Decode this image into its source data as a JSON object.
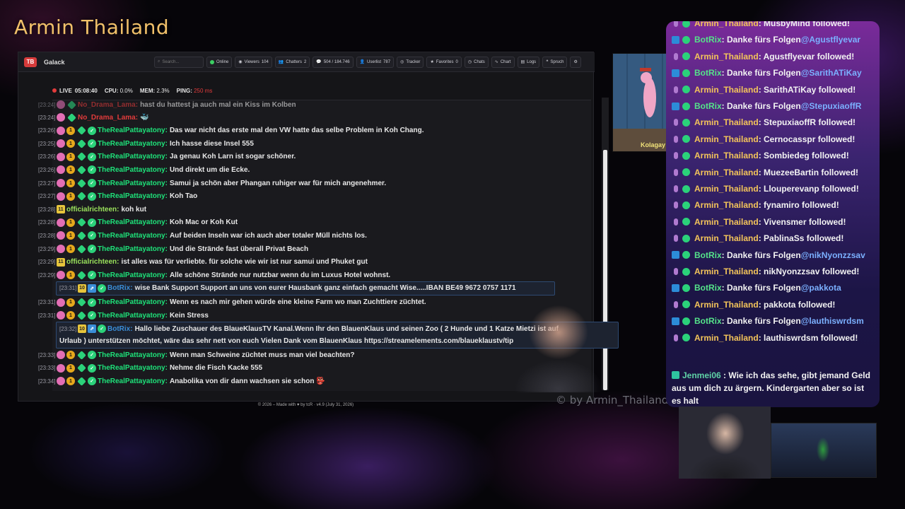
{
  "stream_title": "Armin Thailand",
  "app": {
    "logo_text": "TB",
    "name": "Galack",
    "search_placeholder": "Search...",
    "toolbar": {
      "online": "Online",
      "viewers": "Viewers",
      "viewers_count": "104",
      "chatters": "Chatters",
      "chatters_count": "2",
      "messages": "504 / 184.746",
      "userlist": "Userlist",
      "userlist_count": "787",
      "tracker": "Tracker",
      "favorites": "Favorites",
      "favorites_count": "0",
      "chats": "Chats",
      "chart": "Chart",
      "logs": "Logs",
      "spruch": "Spruch"
    },
    "status": {
      "live": "LIVE",
      "live_time": "05:08:40",
      "cpu_label": "CPU:",
      "cpu": "0.0%",
      "mem_label": "MEM:",
      "mem": "2.3%",
      "ping_label": "PING:",
      "ping": "250 ms"
    },
    "footer": "© 2026 – Made with ♥ by tcR · v4.9 (July 31, 2026)"
  },
  "chat": [
    {
      "time": "[23:24]",
      "user": "No_Drama_Lama",
      "color": "red",
      "badges": [
        "pink",
        "dia"
      ],
      "text": "hast du hattest ja auch mal ein Kiss im Kolben"
    },
    {
      "time": "[23:24]",
      "user": "No_Drama_Lama",
      "color": "red",
      "badges": [
        "pink",
        "dia"
      ],
      "text": "🐳"
    },
    {
      "time": "[23:26]",
      "user": "TheRealPattayatony",
      "color": "green",
      "badges": [
        "pink",
        "gold",
        "dia",
        "ver"
      ],
      "text": "Das war nicht das erste mal den VW hatte das selbe Problem in Koh Chang."
    },
    {
      "time": "[23:25]",
      "user": "TheRealPattayatony",
      "color": "green",
      "badges": [
        "pink",
        "gold",
        "dia",
        "ver"
      ],
      "text": "Ich hasse diese Insel 555"
    },
    {
      "time": "[23:26]",
      "user": "TheRealPattayatony",
      "color": "green",
      "badges": [
        "pink",
        "gold",
        "dia",
        "ver"
      ],
      "text": "Ja genau Koh Larn ist sogar schöner."
    },
    {
      "time": "[23:26]",
      "user": "TheRealPattayatony",
      "color": "green",
      "badges": [
        "pink",
        "gold",
        "dia",
        "ver"
      ],
      "text": "Und direkt um die Ecke."
    },
    {
      "time": "[23:27]",
      "user": "TheRealPattayatony",
      "color": "green",
      "badges": [
        "pink",
        "gold",
        "dia",
        "ver"
      ],
      "text": "Samui ja schön aber Phangan ruhiger war für mich angenehmer."
    },
    {
      "time": "[23:27]",
      "user": "TheRealPattayatony",
      "color": "green",
      "badges": [
        "pink",
        "gold",
        "dia",
        "ver"
      ],
      "text": "Koh Tao"
    },
    {
      "time": "[23:28]",
      "user": "officialrichteen",
      "color": "lime",
      "badges": [
        "sq"
      ],
      "text": "koh kut"
    },
    {
      "time": "[23:28]",
      "user": "TheRealPattayatony",
      "color": "green",
      "badges": [
        "pink",
        "gold",
        "dia",
        "ver"
      ],
      "text": "Koh Mac or Koh Kut"
    },
    {
      "time": "[23:28]",
      "user": "TheRealPattayatony",
      "color": "green",
      "badges": [
        "pink",
        "gold",
        "dia",
        "ver"
      ],
      "text": "Auf beiden Inseln war ich auch aber totaler Müll nichts los."
    },
    {
      "time": "[23:29]",
      "user": "TheRealPattayatony",
      "color": "green",
      "badges": [
        "pink",
        "gold",
        "dia",
        "ver"
      ],
      "text": "Und die Strände fast überall Privat Beach"
    },
    {
      "time": "[23:29]",
      "user": "officialrichteen",
      "color": "lime",
      "badges": [
        "sq"
      ],
      "text": "ist alles was für verliebte. für solche wie wir ist nur samui und Phuket gut"
    },
    {
      "time": "[23:29]",
      "user": "TheRealPattayatony",
      "color": "green",
      "badges": [
        "pink",
        "gold",
        "dia",
        "ver"
      ],
      "text": "Alle schöne Strände nur nutzbar wenn du im Luxus Hotel wohnst."
    },
    {
      "time": "[23:31]",
      "user": "BotRix",
      "color": "blue",
      "badges": [
        "sq10",
        "bot",
        "ver"
      ],
      "text": "wise Bank Support Support an uns von eurer Hausbank ganz einfach gemacht Wise.....IBAN BE49 9672 0757 1171",
      "highlight": true
    },
    {
      "time": "[23:31]",
      "user": "TheRealPattayatony",
      "color": "green",
      "badges": [
        "pink",
        "gold",
        "dia",
        "ver"
      ],
      "text": "Wenn es nach mir gehen würde eine kleine Farm wo man Zuchttiere züchtet."
    },
    {
      "time": "[23:31]",
      "user": "TheRealPattayatony",
      "color": "green",
      "badges": [
        "pink",
        "gold",
        "dia",
        "ver"
      ],
      "text": "Kein Stress"
    },
    {
      "time": "[23:32]",
      "user": "BotRix",
      "color": "blue",
      "badges": [
        "sq10",
        "bot",
        "ver"
      ],
      "text": "Hallo liebe Zuschauer des BlaueKlausTV Kanal.Wenn Ihr den BlauenKlaus und seinen Zoo ( 2 Hunde und 1 Katze Mietzi ist auf",
      "text2": "Urlaub ) unterstützen möchtet, wäre das sehr nett von euch Vielen Dank vom BlauenKlaus https://streamelements.com/blaueklaustv/tip",
      "highlight": true
    },
    {
      "time": "[23:33]",
      "user": "TheRealPattayatony",
      "color": "green",
      "badges": [
        "pink",
        "gold",
        "dia",
        "ver"
      ],
      "text": "Wenn man Schweine züchtet muss man viel beachten?"
    },
    {
      "time": "[23:33]",
      "user": "TheRealPattayatony",
      "color": "green",
      "badges": [
        "pink",
        "gold",
        "dia",
        "ver"
      ],
      "text": "Nehme die Fisch Kacke 555"
    },
    {
      "time": "[23:34]",
      "user": "TheRealPattayatony",
      "color": "green",
      "badges": [
        "pink",
        "gold",
        "dia",
        "ver"
      ],
      "text": "Anabolika von dir dann wachsen sie schon 👺"
    }
  ],
  "cartoon_caption": "Kolagay folgt dem Kanal!",
  "watermark": "© by Armin_Thailand",
  "alerts": [
    {
      "type": "armin",
      "name": "Armin_Thailand",
      "text": " : MusbyMind followed!"
    },
    {
      "type": "bot",
      "name": "BotRix",
      "text": " : Danke fürs Folgen ",
      "mention": "@Agustflyevar"
    },
    {
      "type": "armin",
      "name": "Armin_Thailand",
      "text": " : Agustflyevar followed!"
    },
    {
      "type": "bot",
      "name": "BotRix",
      "text": " : Danke fürs Folgen ",
      "mention": "@SarithATiKay"
    },
    {
      "type": "armin",
      "name": "Armin_Thailand",
      "text": " : SarithATiKay followed!"
    },
    {
      "type": "bot",
      "name": "BotRix",
      "text": " : Danke fürs Folgen ",
      "mention": "@StepuxiaoffR"
    },
    {
      "type": "armin",
      "name": "Armin_Thailand",
      "text": " : StepuxiaoffR followed!"
    },
    {
      "type": "armin",
      "name": "Armin_Thailand",
      "text": " : Cernocasspr followed!"
    },
    {
      "type": "armin",
      "name": "Armin_Thailand",
      "text": " : Sombiedeg followed!"
    },
    {
      "type": "armin",
      "name": "Armin_Thailand",
      "text": " : MuezeeBartin followed!"
    },
    {
      "type": "armin",
      "name": "Armin_Thailand",
      "text": " : Llouperevanp followed!"
    },
    {
      "type": "armin",
      "name": "Armin_Thailand",
      "text": " : fynamiro followed!"
    },
    {
      "type": "armin",
      "name": "Armin_Thailand",
      "text": " : Vivensmer followed!"
    },
    {
      "type": "armin",
      "name": "Armin_Thailand",
      "text": " : PablinaSs followed!"
    },
    {
      "type": "bot",
      "name": "BotRix",
      "text": " : Danke fürs Folgen ",
      "mention": "@nikNyonzzsav"
    },
    {
      "type": "armin",
      "name": "Armin_Thailand",
      "text": " : nikNyonzzsav followed!"
    },
    {
      "type": "bot",
      "name": "BotRix",
      "text": " : Danke fürs Folgen ",
      "mention": "@pakkota"
    },
    {
      "type": "armin",
      "name": "Armin_Thailand",
      "text": " : pakkota followed!"
    },
    {
      "type": "bot",
      "name": "BotRix",
      "text": " : Danke fürs Folgen ",
      "mention": "@lauthiswrdsm"
    },
    {
      "type": "armin",
      "name": "Armin_Thailand",
      "text": " : lauthiswrdsm followed!"
    }
  ],
  "jenmei": {
    "name": "Jenmei06",
    "text": " : Wie ich das sehe, gibt jemand Geld aus um dich zu ärgern. Kindergarten aber so ist es halt"
  },
  "colors": {
    "accent_gold": "#f1c16a",
    "name_green": "#1ee37a",
    "name_red": "#e23b3b",
    "botrix_blue": "#3a8ed8"
  }
}
